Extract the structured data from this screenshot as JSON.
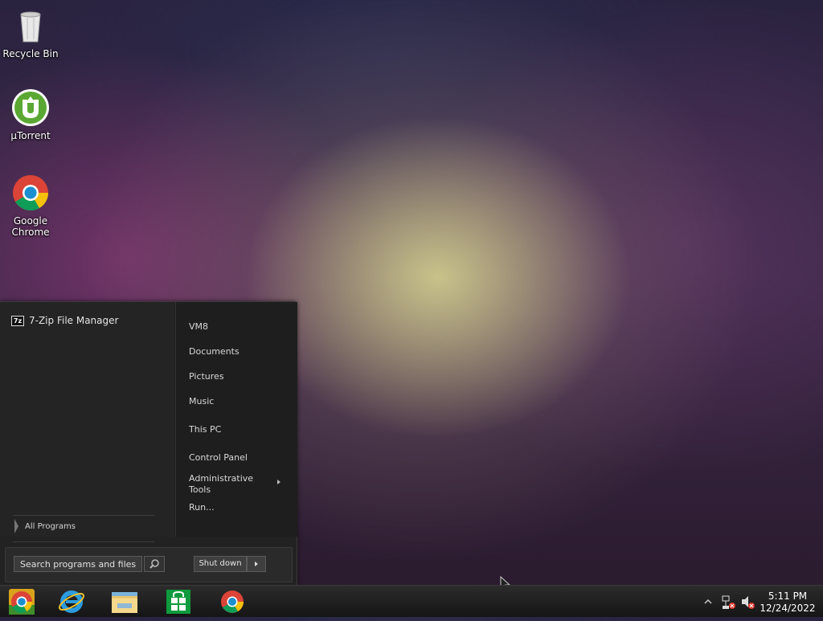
{
  "desktop": {
    "icons": [
      {
        "label": "Recycle Bin",
        "icon": "recycle-bin-icon"
      },
      {
        "label": "µTorrent",
        "icon": "utorrent-icon"
      },
      {
        "label": "Google Chrome",
        "icon": "chrome-icon"
      }
    ]
  },
  "start_menu": {
    "programs": [
      {
        "label": "7-Zip File Manager",
        "icon": "7zip-icon",
        "icon_text": "7z"
      }
    ],
    "all_programs": "All Programs",
    "right_items": [
      "VM8",
      "Documents",
      "Pictures",
      "Music",
      "This PC",
      "Control Panel",
      "Administrative Tools",
      "Run..."
    ],
    "search": {
      "placeholder": "Search programs and files"
    },
    "shutdown": "Shut down"
  },
  "taskbar": {
    "pinned": [
      "start-orb-icon",
      "internet-explorer-icon",
      "file-explorer-icon",
      "store-icon",
      "chrome-icon"
    ],
    "clock": {
      "time": "5:11 PM",
      "date": "12/24/2022"
    }
  },
  "colors": {
    "accent": "#1c8fd1",
    "chrome_red": "#db4437",
    "chrome_yellow": "#f4c20d",
    "chrome_green": "#0f9d58",
    "utorrent_green": "#5aa833"
  }
}
